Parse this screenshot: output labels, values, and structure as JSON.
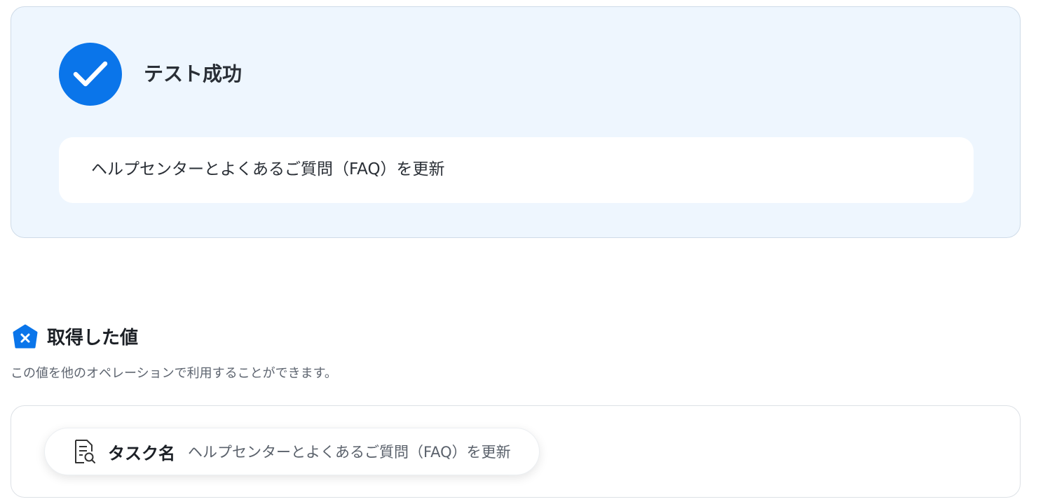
{
  "test_result": {
    "status_title": "テスト成功",
    "result_text": "ヘルプセンターとよくあるご質問（FAQ）を更新",
    "status_icon": "check-icon",
    "accent_color": "#0a75ea"
  },
  "output_section": {
    "heading": "取得した値",
    "heading_icon": "hexagon-x-icon",
    "description": "この値を他のオペレーションで利用することができます。",
    "values": [
      {
        "icon": "document-search-icon",
        "label": "タスク名",
        "value": "ヘルプセンターとよくあるご質問（FAQ）を更新"
      }
    ]
  }
}
